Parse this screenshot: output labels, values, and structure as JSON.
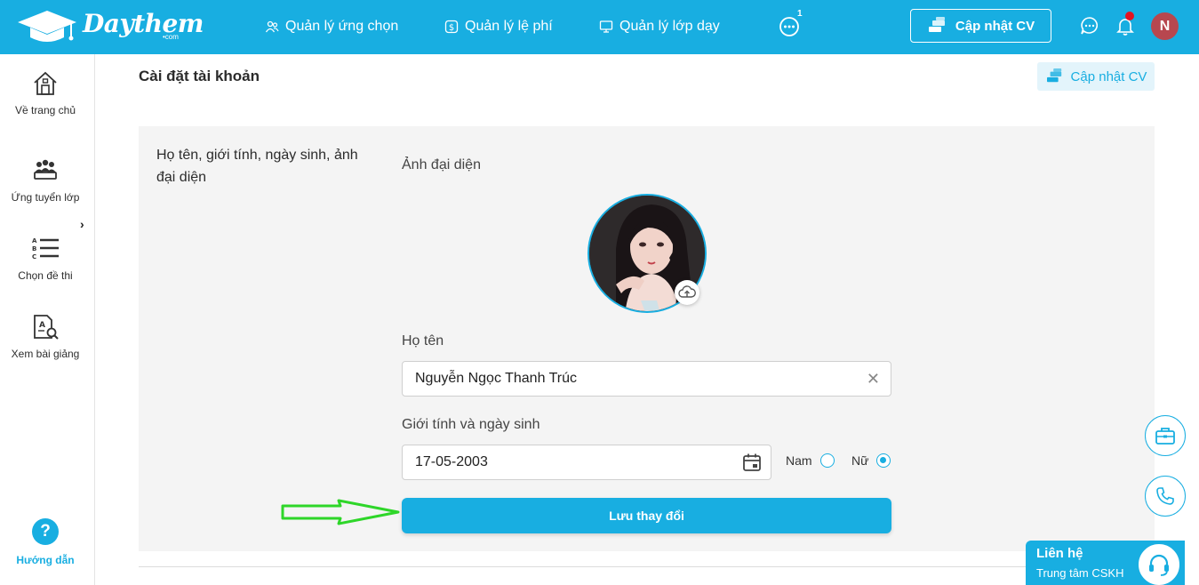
{
  "brand": {
    "name": "Daythem",
    "suffix": "•com",
    "accent": "#18aee1"
  },
  "nav": {
    "items": [
      {
        "label": "Quản lý ứng chọn",
        "icon": "users-icon"
      },
      {
        "label": "Quản lý lệ phí",
        "icon": "fee-icon"
      },
      {
        "label": "Quản lý lớp dạy",
        "icon": "class-icon"
      }
    ],
    "more_badge": "1",
    "cv_button": "Cập nhật CV",
    "avatar_initial": "N"
  },
  "sidebar": {
    "items": [
      {
        "label": "Về trang chủ",
        "icon": "home-icon"
      },
      {
        "label": "Ứng tuyển lớp",
        "icon": "group-icon"
      },
      {
        "label": "Chọn đề thi",
        "icon": "abc-list-icon"
      },
      {
        "label": "Xem bài giảng",
        "icon": "lecture-search-icon"
      }
    ],
    "help": {
      "symbol": "?",
      "label": "Hướng dẫn"
    }
  },
  "main": {
    "title": "Cài đặt tài khoản",
    "cv_button": "Cập nhật CV",
    "section_description": "Họ tên, giới tính, ngày sinh, ảnh đại diện",
    "avatar_label": "Ảnh đại diện",
    "name_label": "Họ tên",
    "name_value": "Nguyễn Ngọc Thanh Trúc",
    "gender_dob_label": "Giới tính và ngày sinh",
    "dob_value": "17-05-2003",
    "gender_options": [
      {
        "label": "Nam",
        "checked": false
      },
      {
        "label": "Nữ",
        "checked": true
      }
    ],
    "save_button": "Lưu thay đổi"
  },
  "contact": {
    "title": "Liên hệ",
    "subtitle": "Trung tâm CSKH"
  }
}
